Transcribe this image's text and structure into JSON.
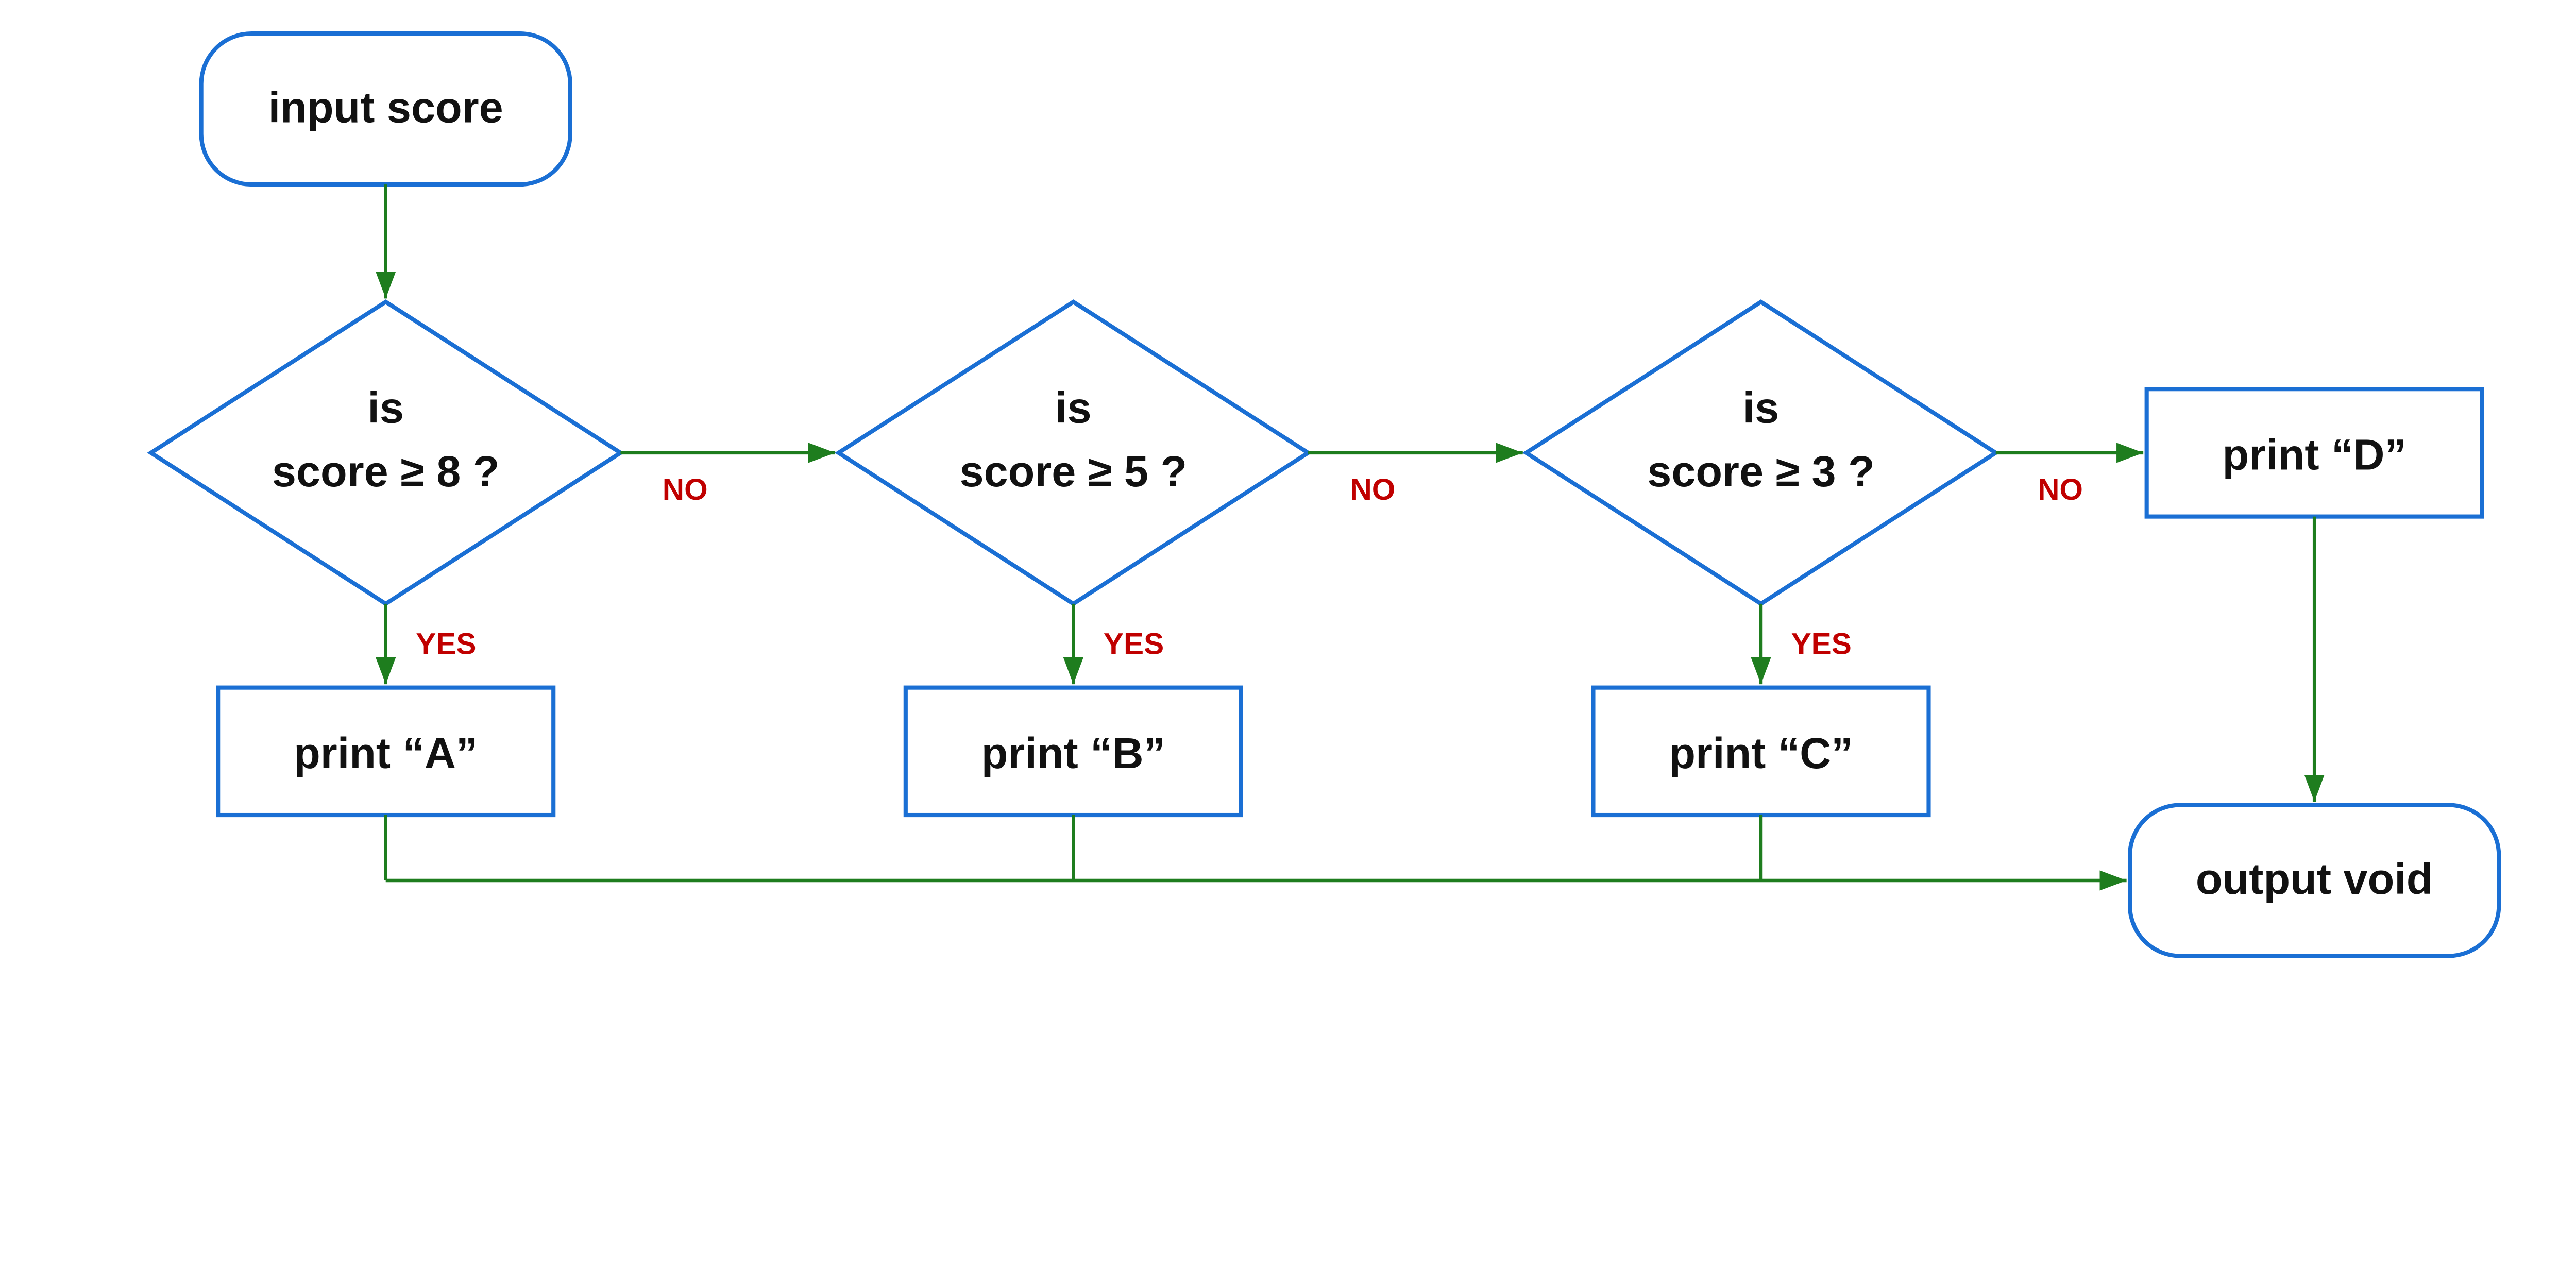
{
  "colors": {
    "stroke": "#1a6fd4",
    "arrow": "#1e7d1e",
    "branch_label": "#c00000",
    "text": "#111111",
    "background": "#ffffff"
  },
  "nodes": {
    "input": {
      "label": "input score"
    },
    "decision1": {
      "line1": "is",
      "line2": "score ≥ 8 ?"
    },
    "decision2": {
      "line1": "is",
      "line2": "score ≥ 5 ?"
    },
    "decision3": {
      "line1": "is",
      "line2": "score ≥ 3 ?"
    },
    "printA": {
      "label": "print “A”"
    },
    "printB": {
      "label": "print “B”"
    },
    "printC": {
      "label": "print “C”"
    },
    "printD": {
      "label": "print “D”"
    },
    "output": {
      "label": "output void"
    }
  },
  "branch_labels": {
    "yes": "YES",
    "no": "NO"
  }
}
